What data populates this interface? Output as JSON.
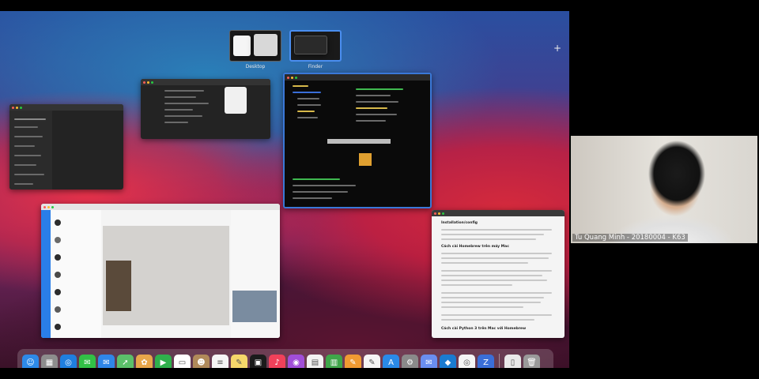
{
  "spaces": [
    {
      "label": "Desktop"
    },
    {
      "label": "Finder"
    }
  ],
  "add_space_glyph": "+",
  "windows": [
    {
      "id": "settings-window",
      "theme": "dark"
    },
    {
      "id": "editor-window",
      "theme": "dark"
    },
    {
      "id": "terminal-window",
      "theme": "terminal"
    },
    {
      "id": "chat-window",
      "theme": "light"
    },
    {
      "id": "document-window",
      "theme": "light"
    }
  ],
  "document": {
    "heading1": "Installation/config",
    "heading2": "Cách cài Homebrew trên máy Mac",
    "heading3": "Cách cài Python 3 trên Mac với Homebrew"
  },
  "dock": {
    "apps": [
      {
        "name": "finder-icon",
        "color": "#2d8ae8",
        "glyph": "☺"
      },
      {
        "name": "launchpad-icon",
        "color": "#8d8d8d",
        "glyph": "▦"
      },
      {
        "name": "safari-icon",
        "color": "#1f7fe0",
        "glyph": "◎"
      },
      {
        "name": "messages-icon",
        "color": "#32c046",
        "glyph": "✉"
      },
      {
        "name": "mail-icon",
        "color": "#2f86e8",
        "glyph": "✉"
      },
      {
        "name": "maps-icon",
        "color": "#5bbf6a",
        "glyph": "➚"
      },
      {
        "name": "photos-icon",
        "color": "#e8a64a",
        "glyph": "✿"
      },
      {
        "name": "facetime-icon",
        "color": "#2fb04c",
        "glyph": "▶"
      },
      {
        "name": "calendar-icon",
        "color": "#ffffff",
        "glyph": "▭"
      },
      {
        "name": "contacts-icon",
        "color": "#b08a5a",
        "glyph": "☻"
      },
      {
        "name": "reminders-icon",
        "color": "#f5f5f5",
        "glyph": "≡"
      },
      {
        "name": "notes-icon",
        "color": "#f6d76a",
        "glyph": "✎"
      },
      {
        "name": "tv-icon",
        "color": "#1b1b1b",
        "glyph": "▣"
      },
      {
        "name": "music-icon",
        "color": "#f0415a",
        "glyph": "♪"
      },
      {
        "name": "podcasts-icon",
        "color": "#a14ed8",
        "glyph": "◉"
      },
      {
        "name": "keynote-icon",
        "color": "#f2f2f2",
        "glyph": "▤"
      },
      {
        "name": "numbers-icon",
        "color": "#3fa64a",
        "glyph": "▥"
      },
      {
        "name": "pages-icon",
        "color": "#f09a32",
        "glyph": "✎"
      },
      {
        "name": "textedit-icon",
        "color": "#f5f5f5",
        "glyph": "✎"
      },
      {
        "name": "app-store-icon",
        "color": "#2a8ae8",
        "glyph": "A"
      },
      {
        "name": "system-preferences-icon",
        "color": "#8a8a8a",
        "glyph": "⚙"
      },
      {
        "name": "messenger-icon",
        "color": "#6a8ef0",
        "glyph": "✉"
      },
      {
        "name": "visual-studio-code-icon",
        "color": "#1a7bd0",
        "glyph": "◆"
      },
      {
        "name": "chrome-icon",
        "color": "#f5f5f5",
        "glyph": "◎"
      },
      {
        "name": "zalo-icon",
        "color": "#3a6ed8",
        "glyph": "Z"
      }
    ],
    "trailing": [
      {
        "name": "downloads-stack-icon",
        "color": "#eaeaea",
        "glyph": "▯"
      },
      {
        "name": "trash-icon",
        "color": "#9a9a9a",
        "glyph": "🗑"
      }
    ]
  },
  "webcam": {
    "name": "Tu Quang Minh - 20180004 - K63"
  }
}
